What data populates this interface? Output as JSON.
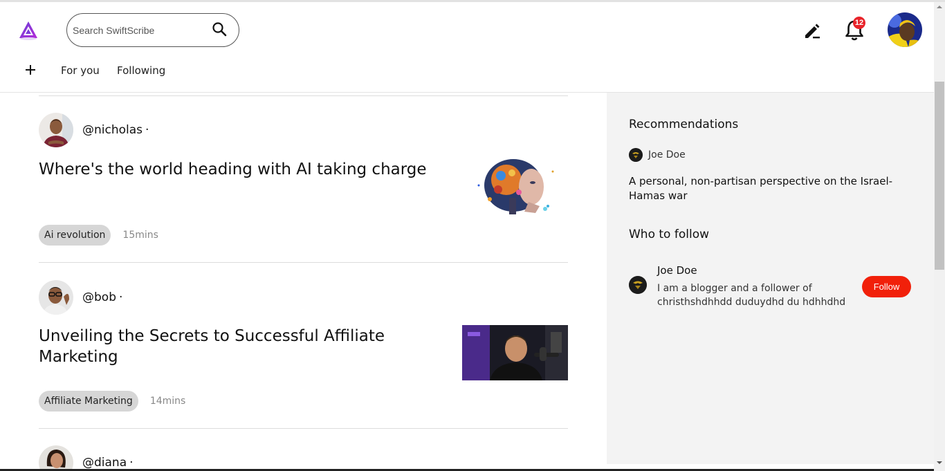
{
  "header": {
    "logo_icon": "swiftscribe-logo-icon",
    "search_placeholder": "Search SwiftScribe",
    "search_icon": "search-icon",
    "write_icon": "write-pencil-icon",
    "bell_icon": "bell-icon",
    "notification_count": "12"
  },
  "tabs": {
    "add_icon": "plus-icon",
    "items": [
      {
        "label": "For you"
      },
      {
        "label": "Following"
      }
    ]
  },
  "feed": {
    "articles": [
      {
        "author": "@nicholas",
        "dot": "·",
        "title": "Where's the world heading with AI taking charge",
        "tag": "Ai revolution",
        "readtime": "15mins"
      },
      {
        "author": "@bob",
        "dot": "·",
        "title": "Unveiling the Secrets to Successful Affiliate Marketing",
        "tag": "Affiliate Marketing",
        "readtime": "14mins"
      },
      {
        "author": "@diana",
        "dot": "·"
      }
    ]
  },
  "sidebar": {
    "recommendations_title": "Recommendations",
    "rec_author": "Joe Doe",
    "rec_article": "A personal, non-partisan perspective on the Israel-Hamas war",
    "who_to_follow_title": "Who to follow",
    "follow_name": "Joe Doe",
    "follow_bio": "I am a blogger and a follower of christhshdhhdd duduydhd du hdhhdhd",
    "follow_button": "Follow"
  },
  "colors": {
    "accent_red": "#f1200a",
    "badge_red": "#e8232a",
    "sidebar_bg": "#f3f3f3",
    "tag_bg": "#d6d6d6"
  }
}
